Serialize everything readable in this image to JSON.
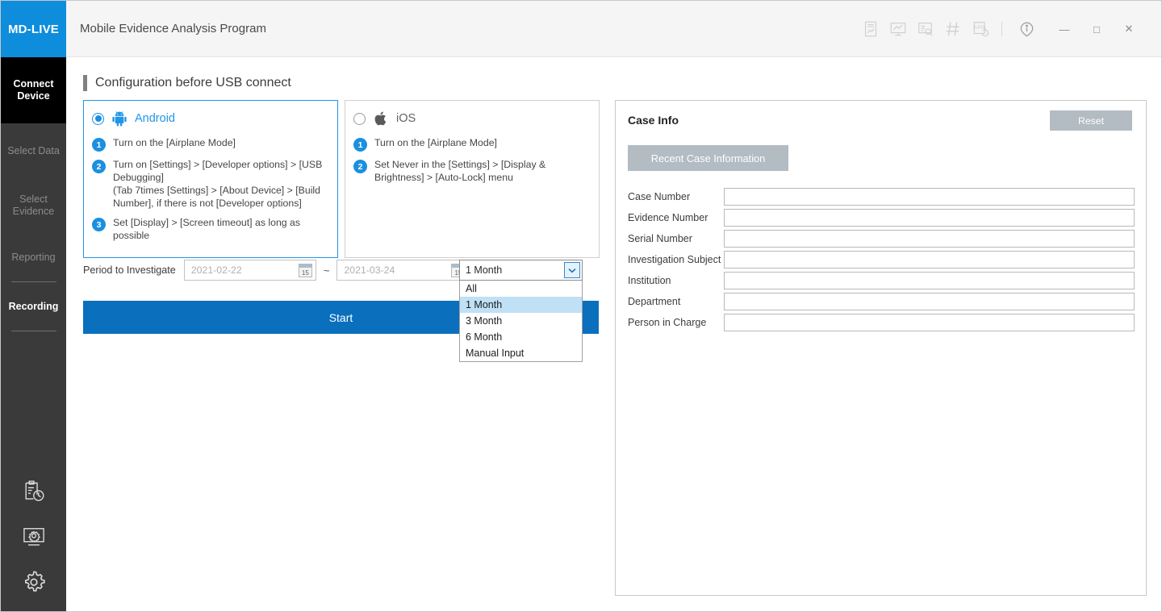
{
  "window": {
    "logo": "MD-LIVE",
    "title": "Mobile Evidence Analysis Program",
    "titlebar_icons": [
      {
        "name": "report-document-icon",
        "glyph": "document-chart"
      },
      {
        "name": "monitor-chart-icon",
        "glyph": "monitor-chart"
      },
      {
        "name": "list-search-icon",
        "glyph": "list-search"
      },
      {
        "name": "hash-icon",
        "glyph": "hash"
      },
      {
        "name": "app-refresh-icon",
        "glyph": "app-refresh",
        "label": "APP"
      },
      {
        "name": "info-icon",
        "glyph": "info"
      }
    ],
    "controls": {
      "minimize": "—",
      "maximize": "□",
      "close": "✕"
    }
  },
  "sidebar": {
    "items": [
      {
        "label": "Connect\nDevice",
        "state": "active"
      },
      {
        "label": "Select Data",
        "state": "disabled"
      },
      {
        "label": "Select\nEvidence",
        "state": "disabled"
      },
      {
        "label": "Reporting",
        "state": "disabled"
      },
      {
        "label": "Recording",
        "state": "enabled"
      }
    ],
    "bottom_icons": [
      {
        "name": "case-history-icon"
      },
      {
        "name": "system-settings-icon"
      },
      {
        "name": "settings-gear-icon"
      }
    ]
  },
  "main": {
    "section_title": "Configuration before USB connect",
    "os_panels": [
      {
        "id": "android",
        "name": "Android",
        "selected": true,
        "icon": "android-robot-icon",
        "steps": [
          {
            "num": "1",
            "text": "Turn on the [Airplane Mode]"
          },
          {
            "num": "2",
            "text": "Turn on [Settings] > [Developer options] > [USB Debugging]\n (Tab 7times [Settings] > [About Device] > [Build Number], if there is not [Developer options]"
          },
          {
            "num": "3",
            "text": "Set [Display] > [Screen timeout] as long as possible"
          }
        ]
      },
      {
        "id": "ios",
        "name": "iOS",
        "selected": false,
        "icon": "apple-logo-icon",
        "steps": [
          {
            "num": "1",
            "text": "Turn on the [Airplane Mode]"
          },
          {
            "num": "2",
            "text": "Set Never in the [Settings] > [Display & Brightness] > [Auto-Lock] menu"
          }
        ]
      }
    ],
    "period": {
      "label": "Period to Investigate",
      "start_date": "2021-02-22",
      "end_date": "2021-03-24",
      "separator": "~",
      "calendar_day": "15"
    },
    "range_select": {
      "value": "1 Month",
      "open": true,
      "options": [
        "All",
        "1 Month",
        "3 Month",
        "6 Month",
        "Manual Input"
      ],
      "selected_index": 1
    },
    "start_button": "Start"
  },
  "case_info": {
    "title": "Case Info",
    "reset_label": "Reset",
    "recent_label": "Recent Case Information",
    "fields": [
      {
        "label": "Case Number",
        "value": ""
      },
      {
        "label": "Evidence Number",
        "value": ""
      },
      {
        "label": "Serial Number",
        "value": ""
      },
      {
        "label": "Investigation Subject",
        "value": ""
      },
      {
        "label": "Institution",
        "value": ""
      },
      {
        "label": "Department",
        "value": ""
      },
      {
        "label": "Person in Charge",
        "value": ""
      }
    ]
  },
  "colors": {
    "brand_blue": "#0d8ddb",
    "accent_blue": "#1b8fe0",
    "start_blue": "#0a6fbd",
    "sidebar_bg": "#3a3a3a",
    "active_nav": "#000000",
    "button_grey": "#b3bbc3",
    "highlight": "#bfe0f5"
  }
}
